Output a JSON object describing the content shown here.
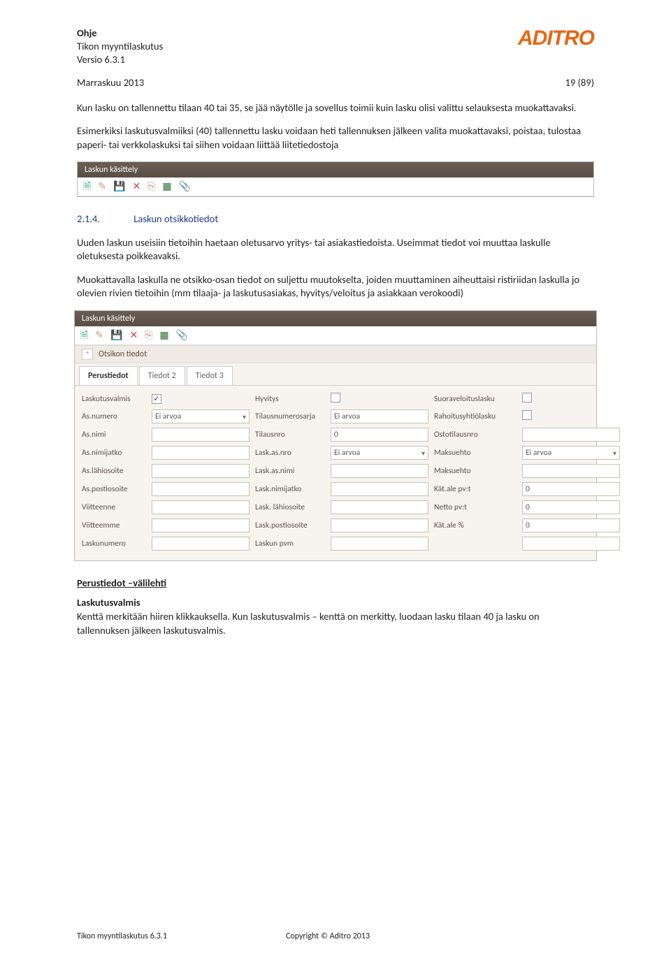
{
  "header": {
    "title": "Ohje",
    "product": "Tikon myyntilaskutus",
    "version": "Versio 6.3.1",
    "date": "Marraskuu 2013",
    "pageno": "19 (89)"
  },
  "logo": "ADITRO",
  "para1": "Kun lasku on tallennettu tilaan 40 tai 35, se jää näytölle ja sovellus toimii kuin lasku olisi valittu selauksesta muokattavaksi.",
  "para2": "Esimerkiksi laskutusvalmiiksi (40) tallennettu lasku voidaan heti tallennuksen jälkeen valita muokattavaksi, poistaa, tulostaa paperi- tai verkkolaskuksi tai siihen voidaan liittää liitetiedostoja",
  "panel1": {
    "title": "Laskun käsittely"
  },
  "section": {
    "no": "2.1.4.",
    "title": "Laskun otsikkotiedot"
  },
  "para3": "Uuden laskun useisiin tietoihin haetaan oletusarvo yritys- tai asiakastiedoista. Useimmat tiedot voi muuttaa laskulle oletuksesta poikkeavaksi.",
  "para4": "Muokattavalla laskulla ne otsikko-osan tiedot on suljettu muutokselta, joiden muuttaminen aiheuttaisi ristiriidan laskulla jo olevien rivien tietoihin (mm tilaaja- ja laskutusasiakas, hyvitys/veloitus ja asiakkaan verokoodi)",
  "panel2": {
    "title": "Laskun käsittely",
    "section": "Otsikon tiedot",
    "tabs": [
      "Perustiedot",
      "Tiedot 2",
      "Tiedot 3"
    ],
    "rows": [
      {
        "l1": "Laskutusvalmis",
        "v1_check": true,
        "l2": "Hyvitys",
        "v2_check": false,
        "l3": "Suoraveloituslasku",
        "v3_check": false
      },
      {
        "l1": "As.numero",
        "v1": "Ei arvoa",
        "v1_dd": true,
        "l2": "Tilausnumerosarja",
        "v2": "Ei arvoa",
        "l3": "Rahoitusyhtiölasku",
        "v3_check": false
      },
      {
        "l1": "As.nimi",
        "v1": "",
        "l2": "Tilausnro",
        "v2": "0",
        "l3": "Ostotilausnro",
        "v3": ""
      },
      {
        "l1": "As.nimijatko",
        "v1": "",
        "l2": "Lask.as.nro",
        "v2": "Ei arvoa",
        "v2_dd": true,
        "l3": "Maksuehto",
        "v3": "Ei arvoa",
        "v3_dd": true
      },
      {
        "l1": "As.lähiosoite",
        "v1": "",
        "l2": "Lask.as.nimi",
        "v2": "",
        "l3": "Maksuehto",
        "v3": ""
      },
      {
        "l1": "As.postiosoite",
        "v1": "",
        "l2": "Lask.nimijatko",
        "v2": "",
        "l3": "Kät.ale pv:t",
        "v3": "0"
      },
      {
        "l1": "Viitteenne",
        "v1": "",
        "l2": "Lask. lähiosoite",
        "v2": "",
        "l3": "Netto pv:t",
        "v3": "0"
      },
      {
        "l1": "Viitteemme",
        "v1": "",
        "l2": "Lask.postiosoite",
        "v2": "",
        "l3": "Kät.ale %",
        "v3": "0"
      },
      {
        "l1": "Laskunumero",
        "v1": "",
        "l2": "Laskun pvm",
        "v2": "",
        "l3": "",
        "v3": ""
      }
    ]
  },
  "sub_heading": "Perustiedot –välilehti",
  "bold_label": "Laskutusvalmis",
  "para5": "Kenttä merkitään hiiren klikkauksella. Kun laskutusvalmis – kenttä on merkitty, luodaan lasku tilaan 40 ja lasku on tallennuksen jälkeen laskutusvalmis.",
  "footer": {
    "left": "Tikon myyntilaskutus 6.3.1",
    "right": "Copyright © Aditro 2013"
  },
  "icons": {
    "new": "new-icon",
    "edit": "edit-icon",
    "save": "save-icon",
    "del": "delete-icon",
    "dup": "duplicate-icon",
    "xls": "excel-icon",
    "clip": "attachment-icon"
  }
}
